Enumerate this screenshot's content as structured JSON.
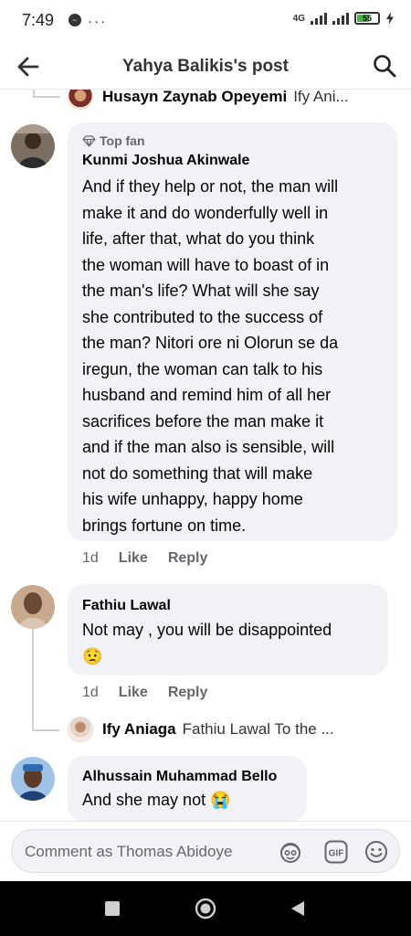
{
  "status_bar": {
    "time": "7:49",
    "extra_icons": "···",
    "network": "4G",
    "battery": "55"
  },
  "header": {
    "title": "Yahya Balikis's post"
  },
  "previous_reply": {
    "name": "Husayn Zaynab Opeyemi",
    "snippet": "Ify Ani..."
  },
  "comments": [
    {
      "badge": "Top fan",
      "name": "Kunmi Joshua Akinwale",
      "lines": [
        "And if they help or not, the man will",
        "make it and do wonderfully well in",
        "life, after that, what do you think",
        "the woman will have to boast of in",
        "the man's life? What will she say",
        "she contributed to the success of",
        "the man? Nitori ore ni Olorun se da",
        "iregun, the woman can talk to his",
        "husband and remind him of all her",
        "sacrifices before the man make it",
        "and if the man also is sensible, will",
        "not do something that will make",
        "his wife unhappy, happy home",
        "brings fortune on time."
      ],
      "time": "1d",
      "like": "Like",
      "reply": "Reply"
    },
    {
      "name": "Fathiu Lawal",
      "text": "Not may , you will be disappointed",
      "emoji": "😟",
      "time": "1d",
      "like": "Like",
      "reply": "Reply"
    },
    {
      "name": "Alhussain Muhammad Bello",
      "text": "And she may not",
      "emoji": "😭"
    }
  ],
  "nested_reply": {
    "name": "Ify Aniaga",
    "snippet": "Fathiu Lawal To the ..."
  },
  "composer": {
    "placeholder": "Comment as Thomas Abidoye",
    "gif_label": "GIF"
  },
  "icons": [
    "back-arrow-icon",
    "search-icon",
    "diamond-icon",
    "avatar-sticker-icon",
    "gif-icon",
    "emoji-icon",
    "square-icon",
    "circle-icon",
    "triangle-icon"
  ],
  "colors": {
    "bubble": "#f0f2f5",
    "secondary_text": "#65676b",
    "primary_text": "#050505"
  }
}
